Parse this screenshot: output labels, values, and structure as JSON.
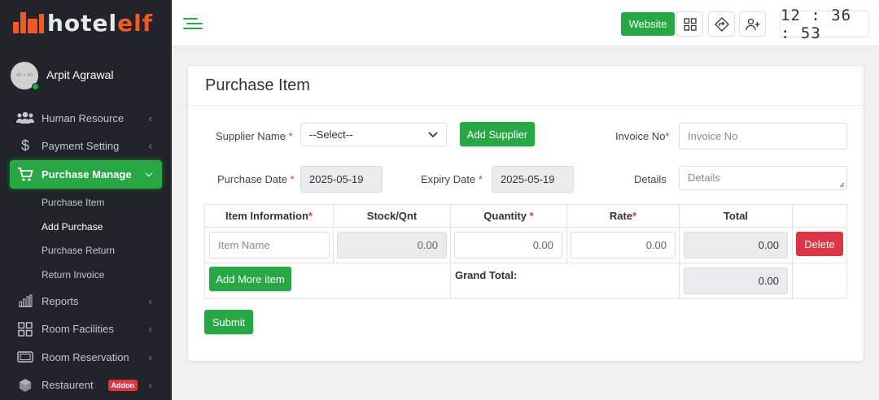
{
  "brand": {
    "name_part1": "hotel",
    "name_part2": "elf"
  },
  "user": {
    "name": "Arpit Agrawal",
    "avatar_text": "40 × 40"
  },
  "sidebar": {
    "items": [
      {
        "label": "Human Resource",
        "icon": "users-icon"
      },
      {
        "label": "Payment Setting",
        "icon": "dollar-icon"
      },
      {
        "label": "Purchase Manage",
        "icon": "cart-icon"
      },
      {
        "label": "Reports",
        "icon": "bar-chart-icon"
      },
      {
        "label": "Room Facilities",
        "icon": "grid-icon"
      },
      {
        "label": "Room Reservation",
        "icon": "reservation-icon"
      },
      {
        "label": "Restaurent",
        "icon": "cube-icon",
        "badge": "Addon"
      }
    ],
    "subitems": [
      "Purchase Item",
      "Add Purchase",
      "Purchase Return",
      "Return Invoice"
    ]
  },
  "topbar": {
    "website_label": "Website",
    "clock": "12 : 36 : 53"
  },
  "page": {
    "title": "Purchase Item"
  },
  "form": {
    "supplier_label": "Supplier Name",
    "supplier_value": "--Select--",
    "add_supplier_label": "Add Supplier",
    "invoice_label": "Invoice No",
    "invoice_placeholder": "Invoice No",
    "purchase_date_label": "Purchase Date",
    "purchase_date_value": "2025-05-19",
    "expiry_date_label": "Expiry Date",
    "expiry_date_value": "2025-05-19",
    "details_label": "Details",
    "details_placeholder": "Details",
    "required_mark": "*"
  },
  "table": {
    "headers": [
      "Item Information",
      "Stock/Qnt",
      "Quantity",
      "Rate",
      "Total"
    ],
    "row": {
      "item_placeholder": "Item Name",
      "stock": "0.00",
      "quantity": "0.00",
      "rate": "0.00",
      "total": "0.00",
      "delete_label": "Delete"
    },
    "add_more_label": "Add More item",
    "grand_total_label": "Grand Total:",
    "grand_total_value": "0.00"
  },
  "submit_label": "Submit",
  "colors": {
    "accent": "#28a745",
    "danger": "#dc3545",
    "brand": "#f05a28",
    "sidebar": "#212529"
  }
}
